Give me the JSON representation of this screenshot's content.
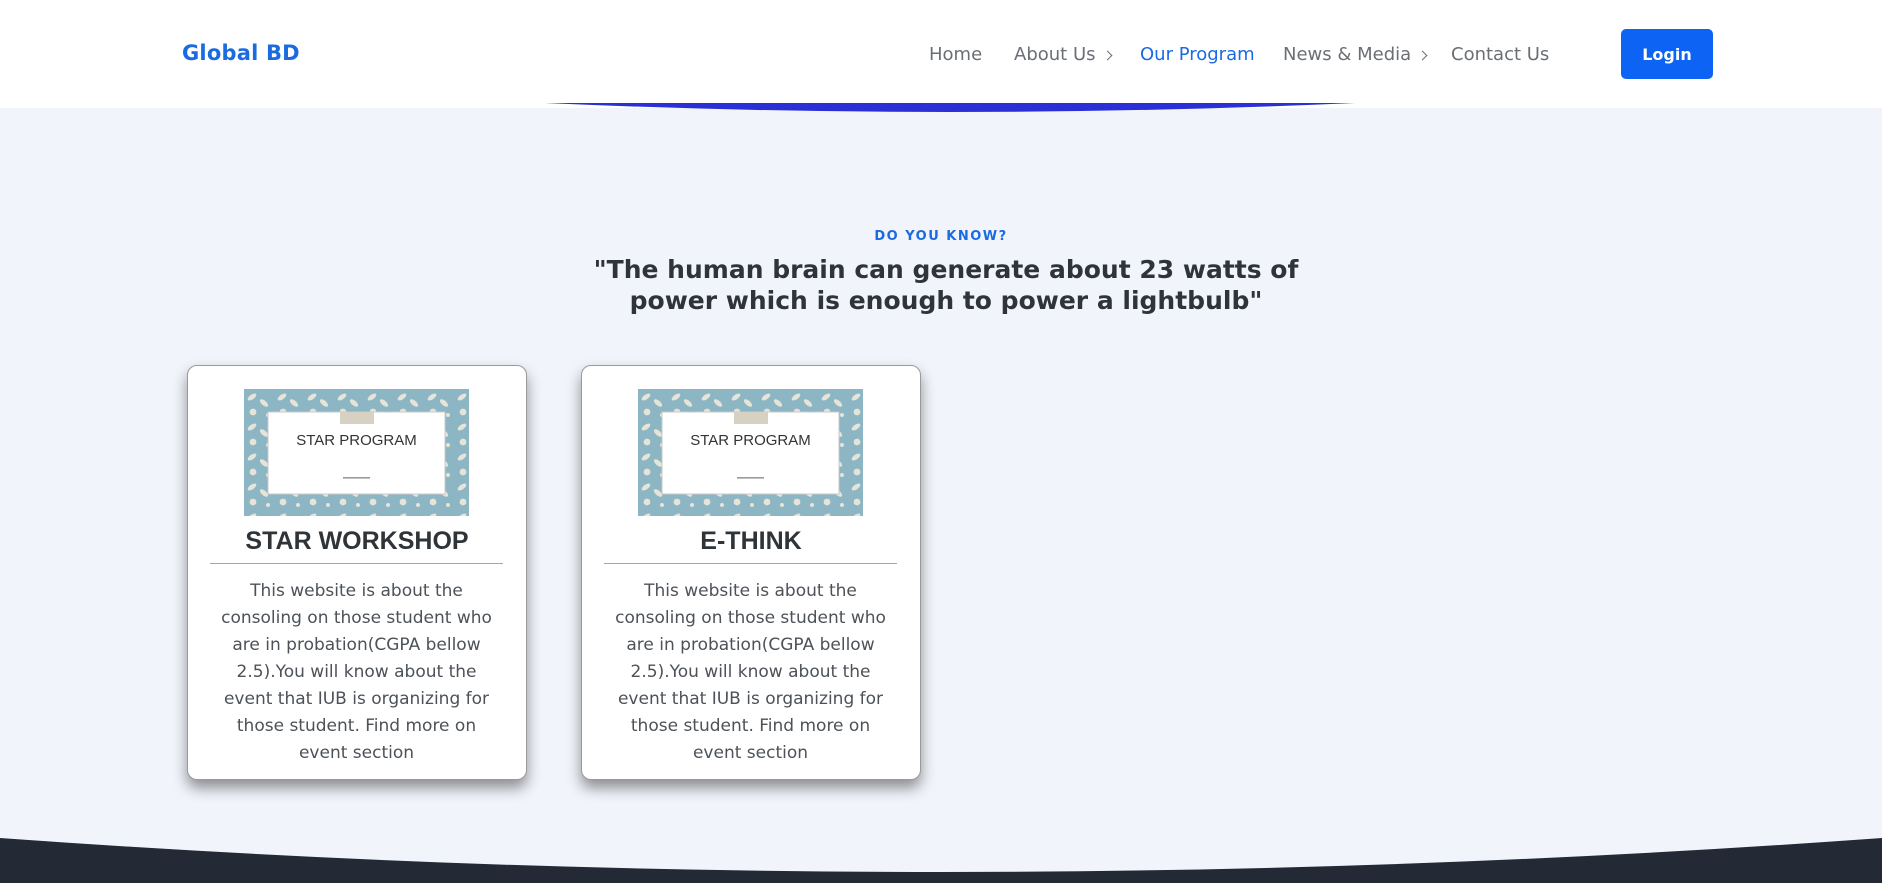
{
  "header": {
    "brand": "Global BD",
    "nav": [
      {
        "label": "Home",
        "has_dropdown": false,
        "active": false
      },
      {
        "label": "About Us",
        "has_dropdown": true,
        "active": false
      },
      {
        "label": "Our Program",
        "has_dropdown": false,
        "active": true
      },
      {
        "label": "News & Media",
        "has_dropdown": true,
        "active": false
      },
      {
        "label": "Contact Us",
        "has_dropdown": false,
        "active": false
      }
    ],
    "login_label": "Login"
  },
  "fact": {
    "kicker": "DO YOU KNOW?",
    "quote": "\"The human brain can generate about 23 watts of power which is enough to power a lightbulb\""
  },
  "cards": [
    {
      "image_text": "STAR PROGRAM",
      "title": "STAR WORKSHOP",
      "description": "This website is about the consoling on those student who are in probation(CGPA bellow 2.5).You will know about the event that IUB is organizing for those student. Find more on event section"
    },
    {
      "image_text": "STAR PROGRAM",
      "title": "E-THINK",
      "description": "This website is about the consoling on those student who are in probation(CGPA bellow 2.5).You will know about the event that IUB is organizing for those student. Find more on event section"
    }
  ],
  "colors": {
    "brand": "#1a6be0",
    "login_button": "#0d63f3",
    "page_background": "#f1f4fb",
    "footer": "#232a35",
    "header_accent_curve": "#2b2fd6",
    "card_image_background": "#8cb6c4"
  }
}
